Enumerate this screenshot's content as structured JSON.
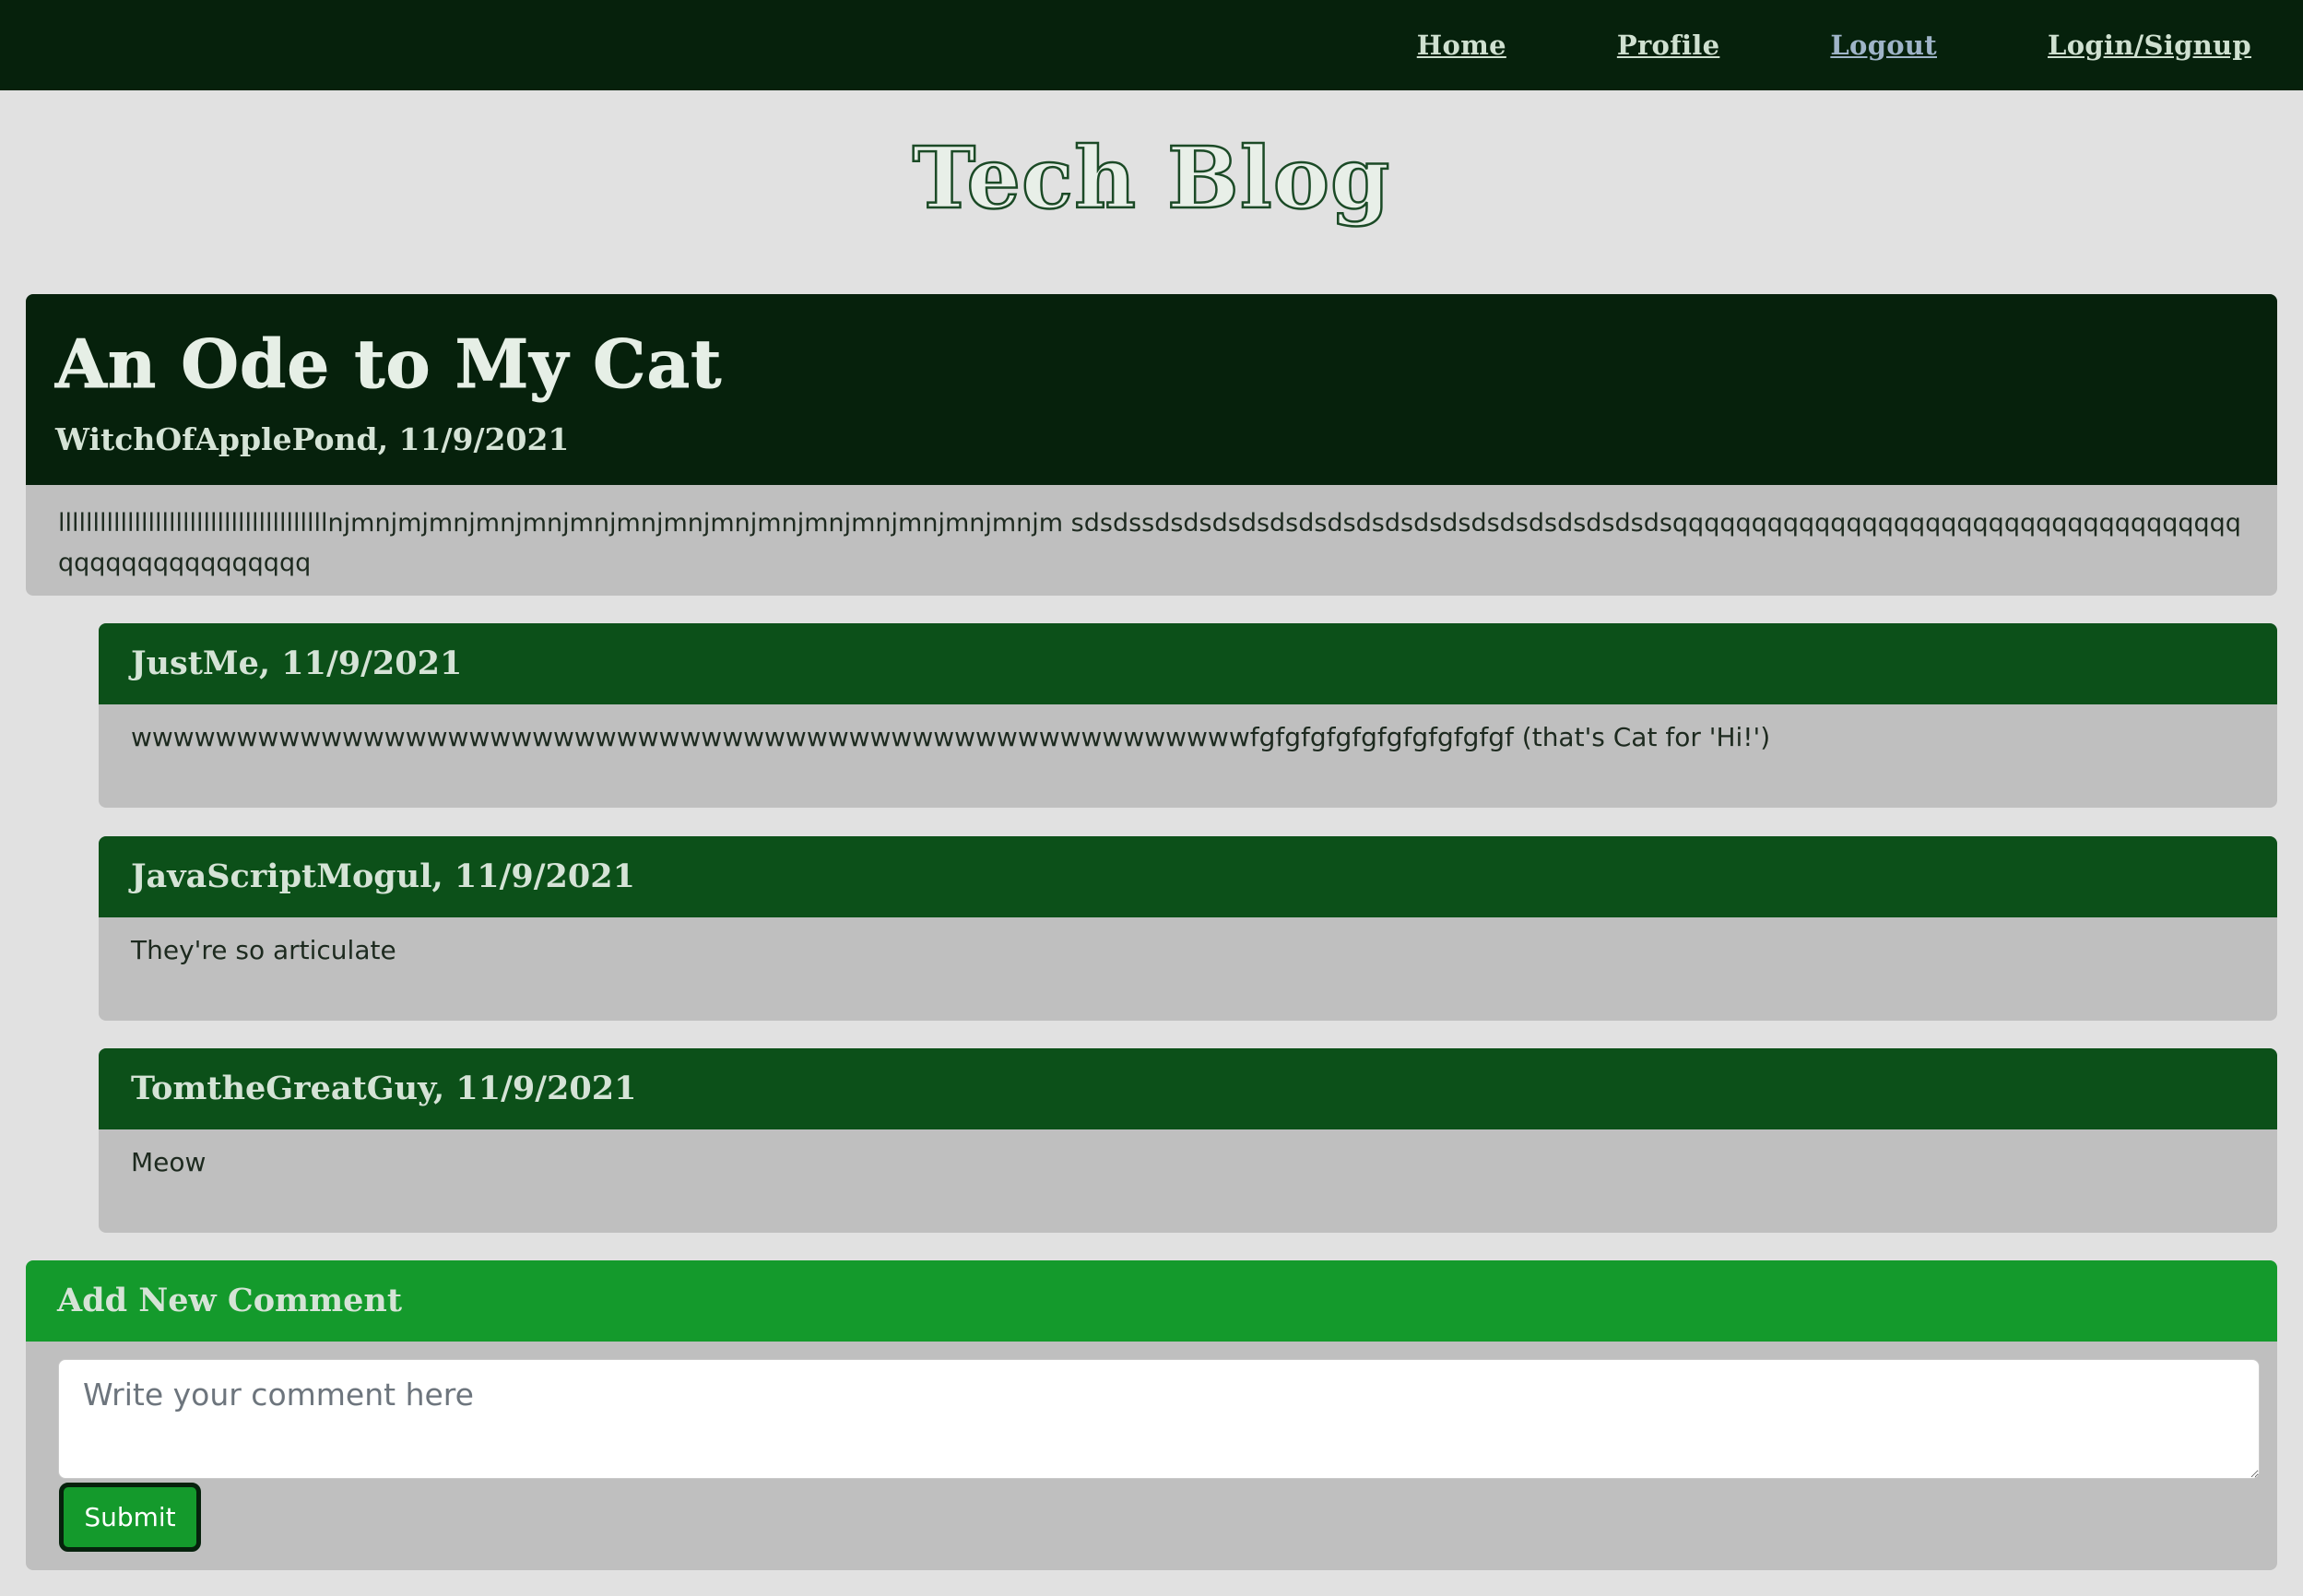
{
  "nav": {
    "links": [
      {
        "label": "Home"
      },
      {
        "label": "Profile"
      },
      {
        "label": "Logout"
      },
      {
        "label": "Login/Signup"
      }
    ]
  },
  "site": {
    "title": "Tech Blog"
  },
  "post": {
    "title": "An Ode to My Cat",
    "meta": "WitchOfApplePond, 11/9/2021",
    "body": "lllllllllllllllllllllllllllllllllllllllnjmnjmjmnjmnjmnjmnjmnjmnjmnjmnjmnjmnjmnjmnjmnjm sdsdssdsdsdsdsdsdsdsdsdsdsdsdsdsdsdsdsdsdsqqqqqqqqqqqqqqqqqqqqqqqqqqqqqqqqqqqqqqqqqqqqqqqqqqqq"
  },
  "comments": [
    {
      "meta": "JustMe, 11/9/2021",
      "body": "wwwwwwwwwwwwwwwwwwwwwwwwwwwwwwwwwwwwwwwwwwwwwwwwwwwwwfgfgfgfgfgfgfgfgfgfgf (that's Cat for 'Hi!')"
    },
    {
      "meta": "JavaScriptMogul, 11/9/2021",
      "body": "They're so articulate"
    },
    {
      "meta": "TomtheGreatGuy, 11/9/2021",
      "body": "Meow"
    }
  ],
  "add_comment": {
    "heading": "Add New Comment",
    "placeholder": "Write your comment here",
    "submit_label": "Submit"
  },
  "colors": {
    "nav_bg": "#06210c",
    "comment_header": "#0c5019",
    "add_header": "#149a2c",
    "card_body": "#bfbfbf",
    "page_bg": "#e1e1e1"
  }
}
